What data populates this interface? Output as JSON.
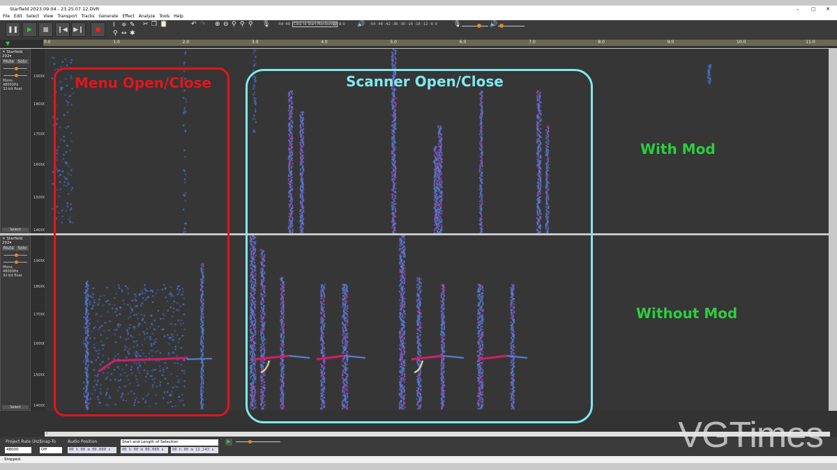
{
  "window": {
    "title": "Starfield 2023.09.04 - 23.25.07.12.DVR",
    "minimize": "–",
    "maximize": "▢",
    "close": "✕"
  },
  "menu": [
    "File",
    "Edit",
    "Select",
    "View",
    "Transport",
    "Tracks",
    "Generate",
    "Effect",
    "Analyze",
    "Tools",
    "Help"
  ],
  "transport": {
    "pause": "❚❚",
    "play": "▶",
    "stop": "■",
    "skip_start": "❙◀",
    "skip_end": "▶❙",
    "record": "●"
  },
  "meters": {
    "record_scale": "-54 -48",
    "monitor_button": "Click to Start Monitoring",
    "record_scale_tail": "-12 -6 0",
    "play_scale": "-54 -48 -42 -36 -30 -24 -18 -12 -6 0"
  },
  "ruler": {
    "ticks": [
      "0.0",
      "1.0",
      "2.0",
      "3.0",
      "4.0",
      "5.0",
      "6.0",
      "7.0",
      "8.0",
      "9.0",
      "10.0",
      "11.0"
    ]
  },
  "tracks": [
    {
      "name": "Starfield 202",
      "mute": "Mute",
      "solo": "Solo",
      "info1": "Mono, 48000Hz",
      "info2": "32-bit float",
      "select": "Select",
      "freq_labels": [
        "19000-",
        "18000-",
        "17000-",
        "16000-",
        "15000-",
        "14000-"
      ]
    },
    {
      "name": "Starfield 202",
      "mute": "Mute",
      "solo": "Solo",
      "info1": "Mono, 48000Hz",
      "info2": "32-bit float",
      "select": "Select",
      "freq_labels": [
        "19000-",
        "18000-",
        "17000-",
        "16000-",
        "15000-",
        "14000-"
      ]
    }
  ],
  "annotations": {
    "menu": "Menu Open/Close",
    "scanner": "Scanner Open/Close",
    "with_mod": "With Mod",
    "without_mod": "Without Mod",
    "colors": {
      "menu": "#e3141e",
      "scanner": "#7fe9ee",
      "mod": "#2ecc40"
    }
  },
  "bottom": {
    "project_rate_label": "Project Rate (Hz)",
    "project_rate": "48000",
    "snap_label": "Snap-To",
    "snap": "Off",
    "audio_pos_label": "Audio Position",
    "audio_pos": "00 h 00 m 00.000 s",
    "selection_label": "Start and Length of Selection",
    "sel_start": "00 h 00 m 00.000 s",
    "sel_length": "00 h 00 m 11.243 s"
  },
  "status": "Stopped.",
  "watermark": "VGTimes"
}
